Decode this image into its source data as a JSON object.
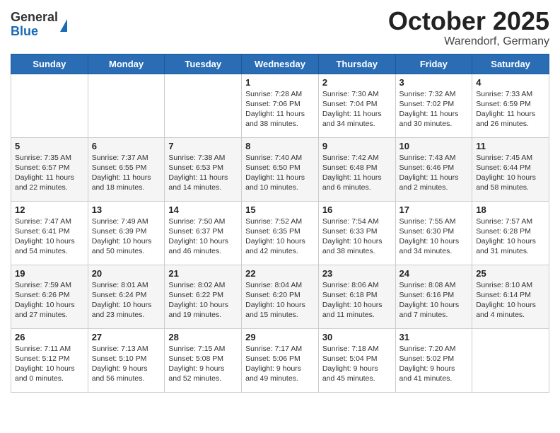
{
  "logo": {
    "general": "General",
    "blue": "Blue"
  },
  "header": {
    "month": "October 2025",
    "location": "Warendorf, Germany"
  },
  "weekdays": [
    "Sunday",
    "Monday",
    "Tuesday",
    "Wednesday",
    "Thursday",
    "Friday",
    "Saturday"
  ],
  "weeks": [
    [
      {
        "day": "",
        "info": ""
      },
      {
        "day": "",
        "info": ""
      },
      {
        "day": "",
        "info": ""
      },
      {
        "day": "1",
        "info": "Sunrise: 7:28 AM\nSunset: 7:06 PM\nDaylight: 11 hours\nand 38 minutes."
      },
      {
        "day": "2",
        "info": "Sunrise: 7:30 AM\nSunset: 7:04 PM\nDaylight: 11 hours\nand 34 minutes."
      },
      {
        "day": "3",
        "info": "Sunrise: 7:32 AM\nSunset: 7:02 PM\nDaylight: 11 hours\nand 30 minutes."
      },
      {
        "day": "4",
        "info": "Sunrise: 7:33 AM\nSunset: 6:59 PM\nDaylight: 11 hours\nand 26 minutes."
      }
    ],
    [
      {
        "day": "5",
        "info": "Sunrise: 7:35 AM\nSunset: 6:57 PM\nDaylight: 11 hours\nand 22 minutes."
      },
      {
        "day": "6",
        "info": "Sunrise: 7:37 AM\nSunset: 6:55 PM\nDaylight: 11 hours\nand 18 minutes."
      },
      {
        "day": "7",
        "info": "Sunrise: 7:38 AM\nSunset: 6:53 PM\nDaylight: 11 hours\nand 14 minutes."
      },
      {
        "day": "8",
        "info": "Sunrise: 7:40 AM\nSunset: 6:50 PM\nDaylight: 11 hours\nand 10 minutes."
      },
      {
        "day": "9",
        "info": "Sunrise: 7:42 AM\nSunset: 6:48 PM\nDaylight: 11 hours\nand 6 minutes."
      },
      {
        "day": "10",
        "info": "Sunrise: 7:43 AM\nSunset: 6:46 PM\nDaylight: 11 hours\nand 2 minutes."
      },
      {
        "day": "11",
        "info": "Sunrise: 7:45 AM\nSunset: 6:44 PM\nDaylight: 10 hours\nand 58 minutes."
      }
    ],
    [
      {
        "day": "12",
        "info": "Sunrise: 7:47 AM\nSunset: 6:41 PM\nDaylight: 10 hours\nand 54 minutes."
      },
      {
        "day": "13",
        "info": "Sunrise: 7:49 AM\nSunset: 6:39 PM\nDaylight: 10 hours\nand 50 minutes."
      },
      {
        "day": "14",
        "info": "Sunrise: 7:50 AM\nSunset: 6:37 PM\nDaylight: 10 hours\nand 46 minutes."
      },
      {
        "day": "15",
        "info": "Sunrise: 7:52 AM\nSunset: 6:35 PM\nDaylight: 10 hours\nand 42 minutes."
      },
      {
        "day": "16",
        "info": "Sunrise: 7:54 AM\nSunset: 6:33 PM\nDaylight: 10 hours\nand 38 minutes."
      },
      {
        "day": "17",
        "info": "Sunrise: 7:55 AM\nSunset: 6:30 PM\nDaylight: 10 hours\nand 34 minutes."
      },
      {
        "day": "18",
        "info": "Sunrise: 7:57 AM\nSunset: 6:28 PM\nDaylight: 10 hours\nand 31 minutes."
      }
    ],
    [
      {
        "day": "19",
        "info": "Sunrise: 7:59 AM\nSunset: 6:26 PM\nDaylight: 10 hours\nand 27 minutes."
      },
      {
        "day": "20",
        "info": "Sunrise: 8:01 AM\nSunset: 6:24 PM\nDaylight: 10 hours\nand 23 minutes."
      },
      {
        "day": "21",
        "info": "Sunrise: 8:02 AM\nSunset: 6:22 PM\nDaylight: 10 hours\nand 19 minutes."
      },
      {
        "day": "22",
        "info": "Sunrise: 8:04 AM\nSunset: 6:20 PM\nDaylight: 10 hours\nand 15 minutes."
      },
      {
        "day": "23",
        "info": "Sunrise: 8:06 AM\nSunset: 6:18 PM\nDaylight: 10 hours\nand 11 minutes."
      },
      {
        "day": "24",
        "info": "Sunrise: 8:08 AM\nSunset: 6:16 PM\nDaylight: 10 hours\nand 7 minutes."
      },
      {
        "day": "25",
        "info": "Sunrise: 8:10 AM\nSunset: 6:14 PM\nDaylight: 10 hours\nand 4 minutes."
      }
    ],
    [
      {
        "day": "26",
        "info": "Sunrise: 7:11 AM\nSunset: 5:12 PM\nDaylight: 10 hours\nand 0 minutes."
      },
      {
        "day": "27",
        "info": "Sunrise: 7:13 AM\nSunset: 5:10 PM\nDaylight: 9 hours\nand 56 minutes."
      },
      {
        "day": "28",
        "info": "Sunrise: 7:15 AM\nSunset: 5:08 PM\nDaylight: 9 hours\nand 52 minutes."
      },
      {
        "day": "29",
        "info": "Sunrise: 7:17 AM\nSunset: 5:06 PM\nDaylight: 9 hours\nand 49 minutes."
      },
      {
        "day": "30",
        "info": "Sunrise: 7:18 AM\nSunset: 5:04 PM\nDaylight: 9 hours\nand 45 minutes."
      },
      {
        "day": "31",
        "info": "Sunrise: 7:20 AM\nSunset: 5:02 PM\nDaylight: 9 hours\nand 41 minutes."
      },
      {
        "day": "",
        "info": ""
      }
    ]
  ]
}
